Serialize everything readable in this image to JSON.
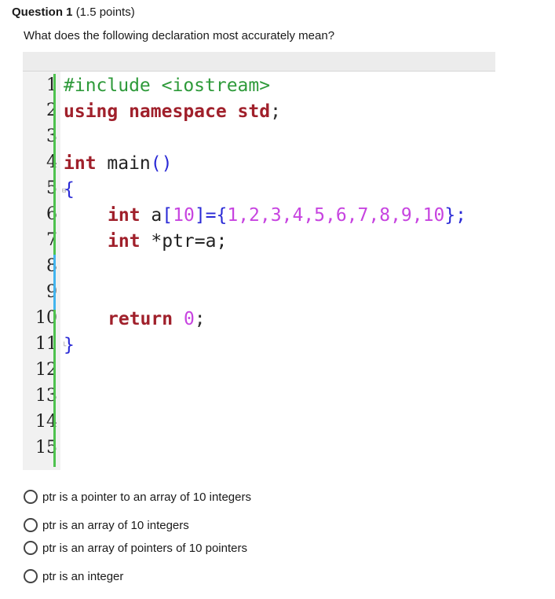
{
  "question": {
    "title": "Question 1",
    "points": "(1.5 points)",
    "prompt": "What does the following declaration most accurately mean?"
  },
  "code": {
    "line_numbers": [
      "1",
      "2",
      "3",
      "4",
      "5",
      "6",
      "7",
      "8",
      "9",
      "10",
      "11",
      "12",
      "13",
      "14",
      "15"
    ],
    "lines": {
      "l1_include": "#include",
      "l1_header": " <iostream>",
      "l2_using": "using namespace std",
      "l2_semi": ";",
      "l4_int": "int",
      "l4_main": " main",
      "l4_parens": "()",
      "l5_brace": "{",
      "l6_int": "int",
      "l6_a": " a",
      "l6_lbr": "[",
      "l6_ten": "10",
      "l6_rbr_eq_lbrace": "]={",
      "l6_values": "1,2,3,4,5,6,7,8,9,10",
      "l6_end": "};",
      "l7_int": "int",
      "l7_ptr": " *ptr=a;",
      "l10_return": "return",
      "l10_zero": " 0",
      "l10_semi": ";",
      "l11_brace": "}"
    },
    "fold_markers": {
      "open": "⊟",
      "close": "└"
    }
  },
  "options": [
    {
      "label": "ptr is a pointer to an array of 10 integers"
    },
    {
      "label": "ptr is an array of 10 integers"
    },
    {
      "label": "ptr is an array of pointers of 10 pointers"
    },
    {
      "label": "ptr is an integer"
    }
  ],
  "colors": {
    "preprocessor": "#2e9a3a",
    "keyword": "#a0202b",
    "number": "#c744e0",
    "brace": "#2a2ad6",
    "gutter_bar_green": "#4ec24e",
    "gutter_bar_blue": "#42b4ee"
  }
}
